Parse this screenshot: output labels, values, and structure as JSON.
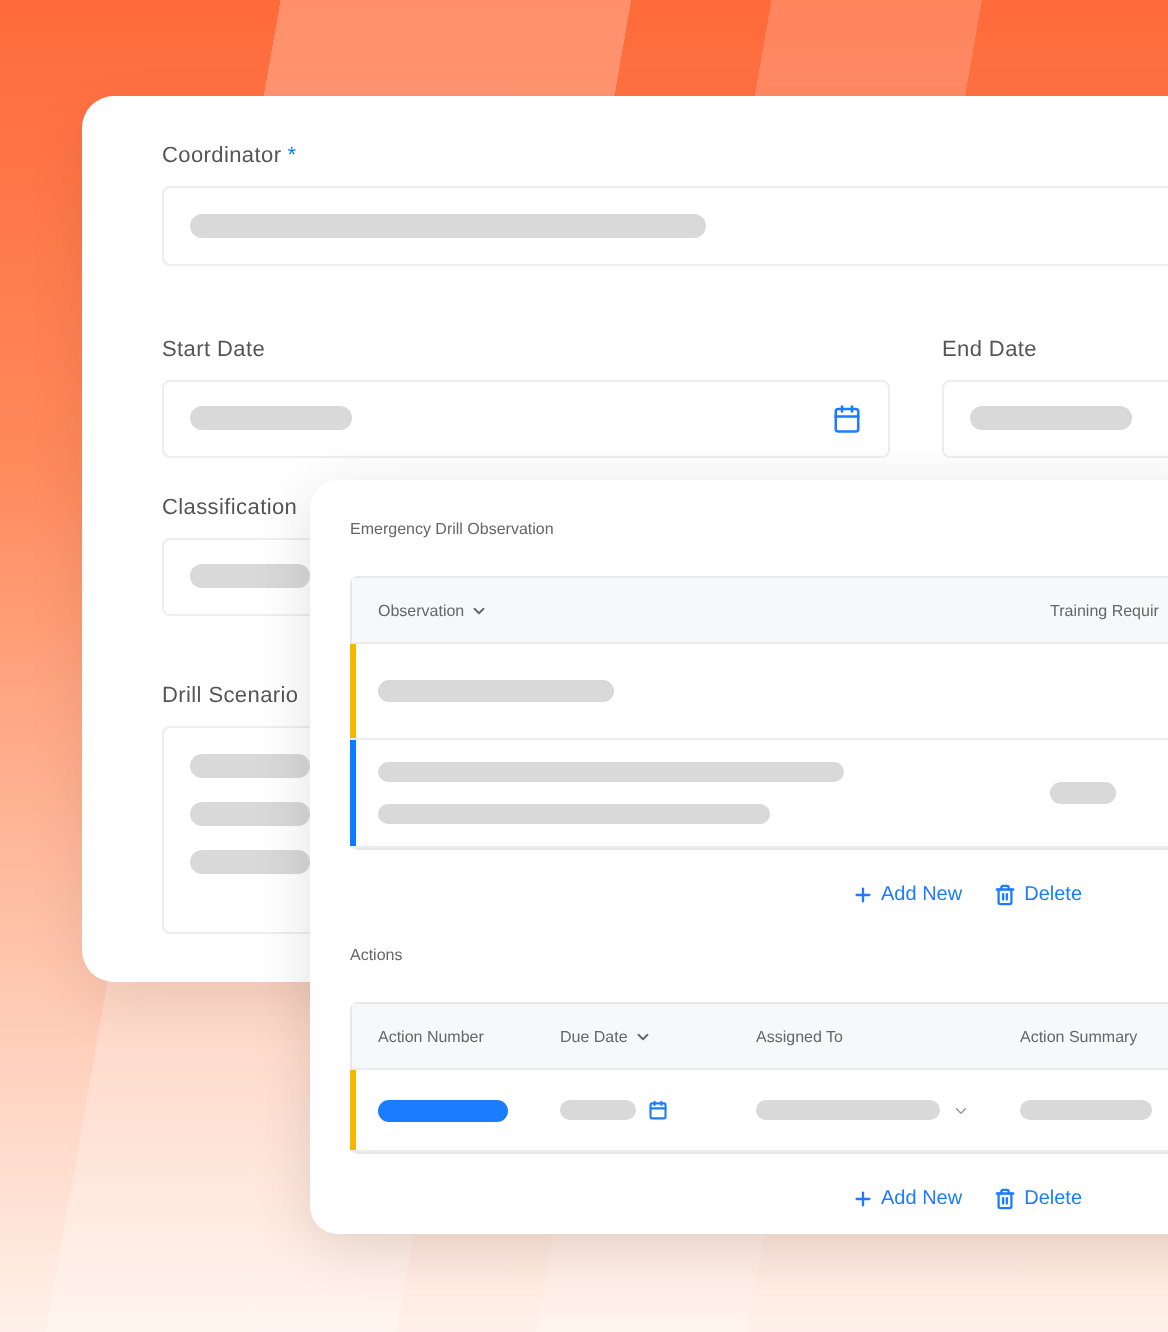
{
  "details_card": {
    "coordinator": {
      "label": "Coordinator",
      "required_mark": "*"
    },
    "start_date": {
      "label": "Start Date"
    },
    "end_date": {
      "label": "End Date"
    },
    "classification": {
      "label": "Classification"
    },
    "drill_scenario": {
      "label": "Drill Scenario"
    }
  },
  "observation_section": {
    "title": "Emergency Drill Observation",
    "columns": [
      {
        "label": "Observation",
        "sortable": true
      },
      {
        "label": "Training Requir"
      }
    ],
    "rows": [
      {
        "kind": "single-line",
        "color": "#f5b800"
      },
      {
        "kind": "multi-line",
        "color": "#0a7cff"
      }
    ],
    "add_button": "Add New",
    "delete_button": "Delete"
  },
  "actions_section": {
    "title": "Actions",
    "columns": [
      {
        "label": "Action Number",
        "sortable": false
      },
      {
        "label": "Due Date",
        "sortable": true
      },
      {
        "label": "Assigned To",
        "sortable": false
      },
      {
        "label": "Action Summary",
        "sortable": false
      }
    ],
    "rows": [
      {
        "color": "#f5b800"
      }
    ],
    "add_button": "Add New",
    "delete_button": "Delete"
  }
}
